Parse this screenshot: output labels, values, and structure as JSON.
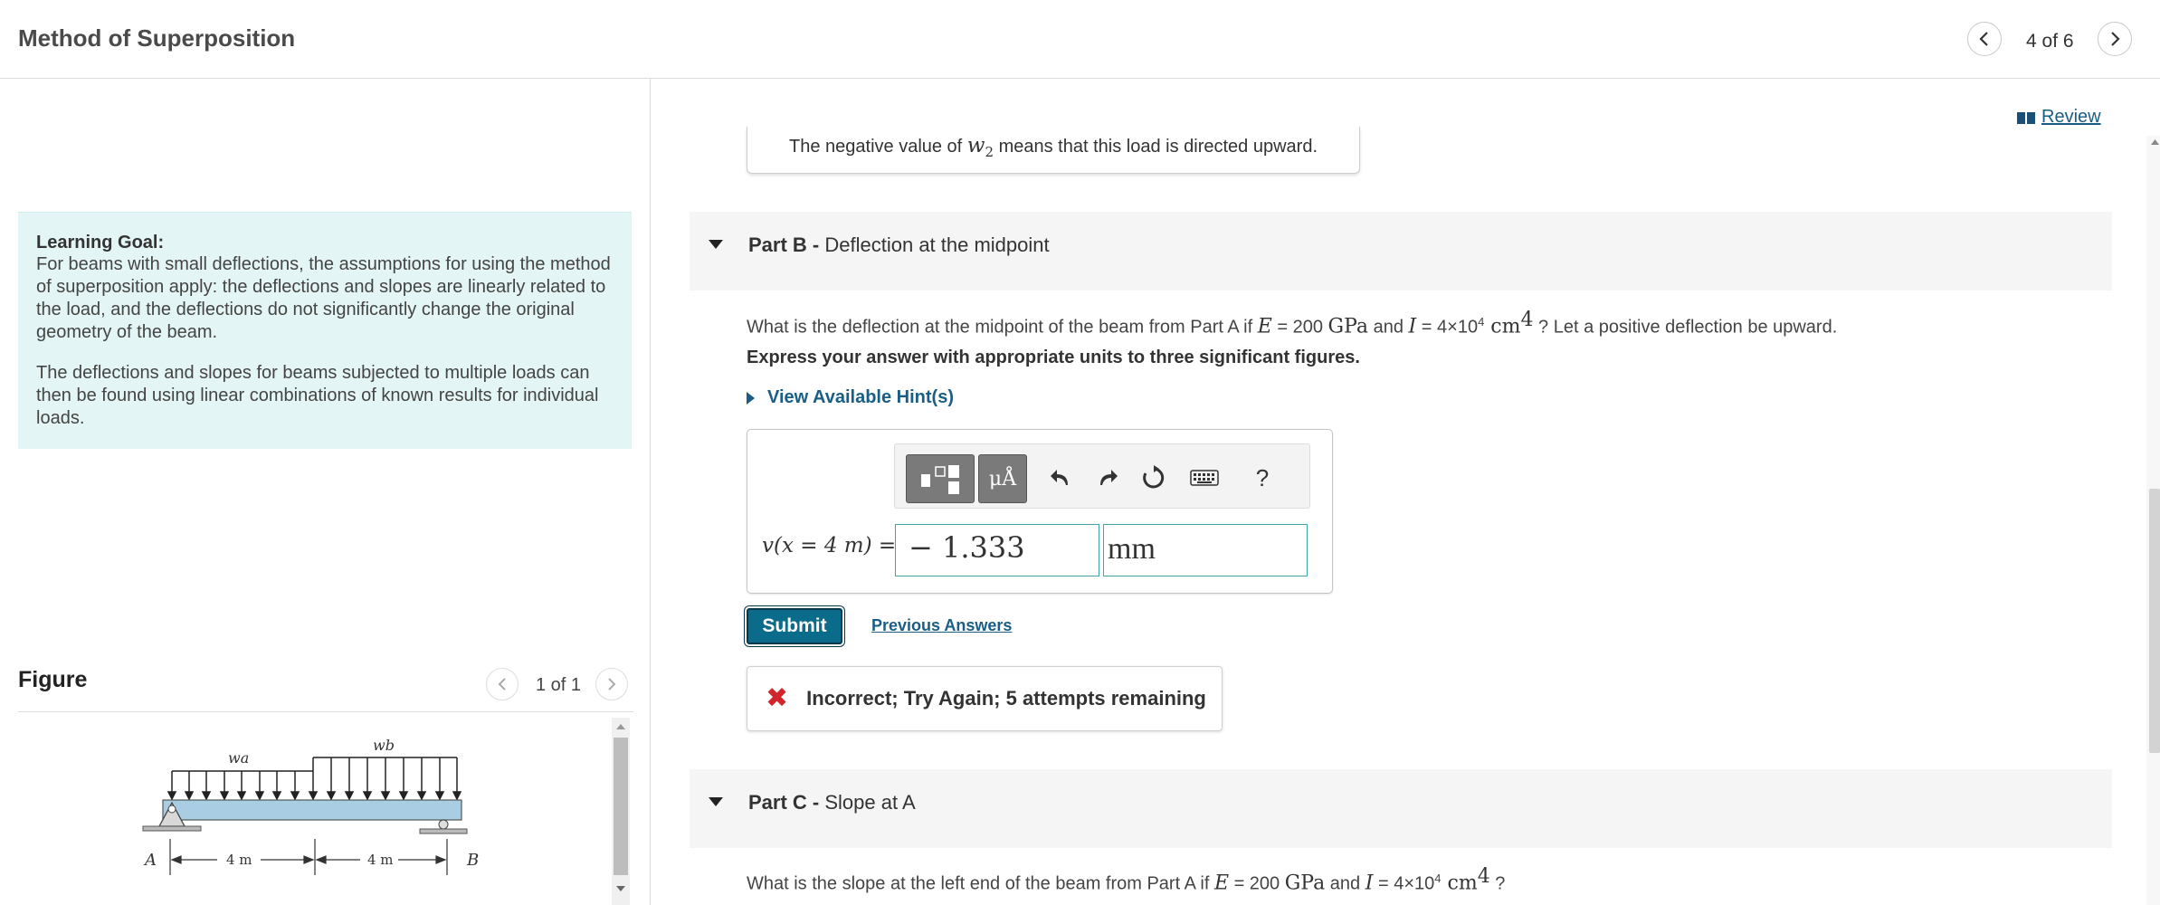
{
  "header": {
    "title": "Method of Superposition",
    "page_counter": "4 of 6",
    "prev_icon": "chevron-left-icon",
    "next_icon": "chevron-right-icon"
  },
  "review": {
    "label": "Review",
    "icon": "book-icon"
  },
  "learning_goal": {
    "title": "Learning Goal:",
    "paragraph1": "For beams with small deflections, the assumptions for using the method of superposition apply: the deflections and slopes are linearly related to the load, and the deflections do not significantly change the original geometry of the beam.",
    "paragraph2": "The deflections and slopes for beams subjected to multiple loads can then be found using linear combinations of known results for individual loads."
  },
  "figure": {
    "label": "Figure",
    "page_counter": "1 of 1",
    "labels": {
      "wa": "wa",
      "wb": "wb",
      "A": "A",
      "B": "B",
      "span1": "4 m",
      "span2": "4 m"
    }
  },
  "previous_note": {
    "text_before": "The negative value of ",
    "symbol": "w",
    "subscript": "2",
    "text_after": " means that this load is directed upward."
  },
  "part_b": {
    "label": "Part B -",
    "title": "Deflection at the midpoint",
    "question_start": "What is the deflection at the midpoint of the beam from Part A if ",
    "E_sym": "E",
    "E_val": " = 200 ",
    "E_unit": "GPa",
    "and": " and ",
    "I_sym": "I",
    "I_val": " = 4×10",
    "I_exp": "4",
    "I_unit": " cm",
    "I_unit_exp": "4",
    "question_end": " ? Let a positive deflection be upward.",
    "instruction": "Express your answer with appropriate units to three significant figures.",
    "hint_label": "View Available Hint(s)",
    "toolbar": {
      "template_icon": "template-icon",
      "units_label": "μÅ",
      "undo_icon": "undo-icon",
      "redo_icon": "redo-icon",
      "reset_icon": "reset-icon",
      "keyboard_icon": "keyboard-icon",
      "help_label": "?"
    },
    "variable_label": "v(x = 4 m) =",
    "answer_value": "− 1.333",
    "answer_unit": "mm",
    "submit_label": "Submit",
    "previous_answers_label": "Previous Answers",
    "feedback": "Incorrect; Try Again; 5 attempts remaining"
  },
  "part_c": {
    "label": "Part C -",
    "title": "Slope at A",
    "question_start": "What is the slope at the left end of the beam from Part A if ",
    "E_sym": "E",
    "E_val": " = 200 ",
    "E_unit": "GPa",
    "and": " and ",
    "I_sym": "I",
    "I_val": " = 4×10",
    "I_exp": "4",
    "I_unit": " cm",
    "I_unit_exp": "4",
    "question_end": " ?"
  },
  "colors": {
    "accent": "#1a5e85",
    "submit_bg": "#0a6b8a",
    "learning_goal_bg": "#e4f5f5",
    "error": "#d0262b",
    "beam": "#a9cde3"
  }
}
